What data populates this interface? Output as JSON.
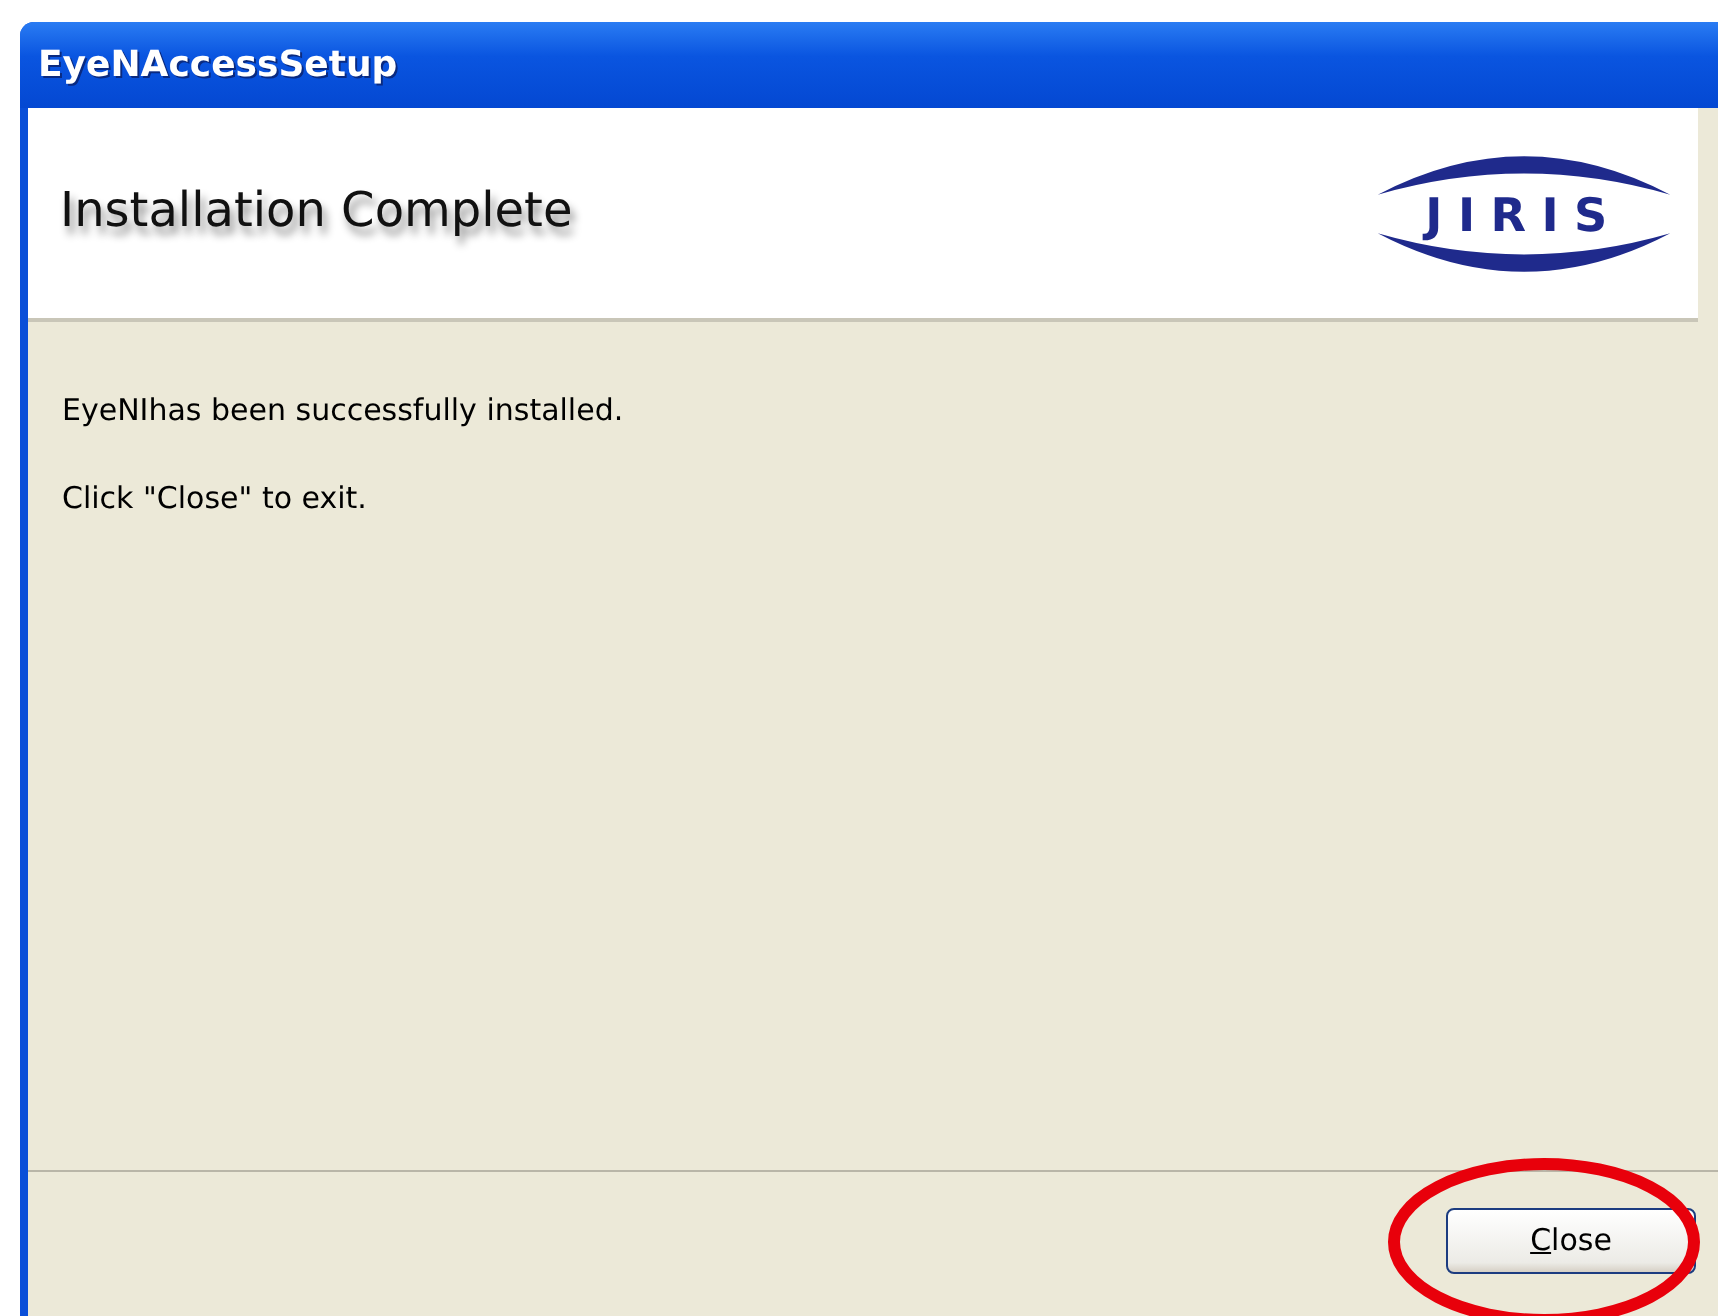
{
  "window": {
    "title": "EyeNAccessSetup"
  },
  "header": {
    "title": "Installation Complete",
    "logo_text": "JIRIS"
  },
  "body": {
    "messages": [
      "EyeNIhas been successfully installed.",
      "Click \"Close\" to exit."
    ]
  },
  "buttons": [
    {
      "label": "Close",
      "underline_first": true
    }
  ],
  "annotation": {
    "kind": "ellipse",
    "color": "#e8000b"
  }
}
